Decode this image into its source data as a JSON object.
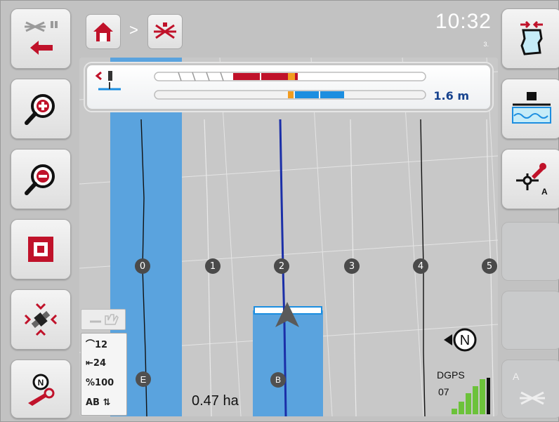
{
  "header": {
    "time": "10:32",
    "time_sub": "3.",
    "breadcrumb_separator": ">"
  },
  "lightbar": {
    "distance": "1.6 m"
  },
  "map": {
    "track_numbers": [
      "0",
      "1",
      "2",
      "3",
      "4",
      "5"
    ],
    "area": "0.47 ha",
    "field_marker": "E",
    "boundary_marker": "B"
  },
  "info_panel": {
    "rows": [
      {
        "icon": "turn-icon",
        "value": "12"
      },
      {
        "icon": "working-width-icon",
        "value": "24"
      },
      {
        "icon": "percent-icon",
        "value": "100"
      },
      {
        "icon": "ab-line-icon",
        "value": "AB ⇅"
      }
    ],
    "row0": "⌒12",
    "row1": "⇤24",
    "row2": "%100",
    "row3": "AB ⇅"
  },
  "gps": {
    "mode": "DGPS",
    "satellites": "07",
    "signal_level": 5,
    "signal_max": 6
  },
  "compass": {
    "label": "N"
  },
  "colors": {
    "accent_red": "#c0122a",
    "track_blue": "#5aa3de",
    "guide_blue": "#1b2fa8",
    "lightbar_blue": "#1c8ee0",
    "gps_green": "#6cc23a"
  },
  "right_buttons": {
    "r6_label": "A"
  }
}
